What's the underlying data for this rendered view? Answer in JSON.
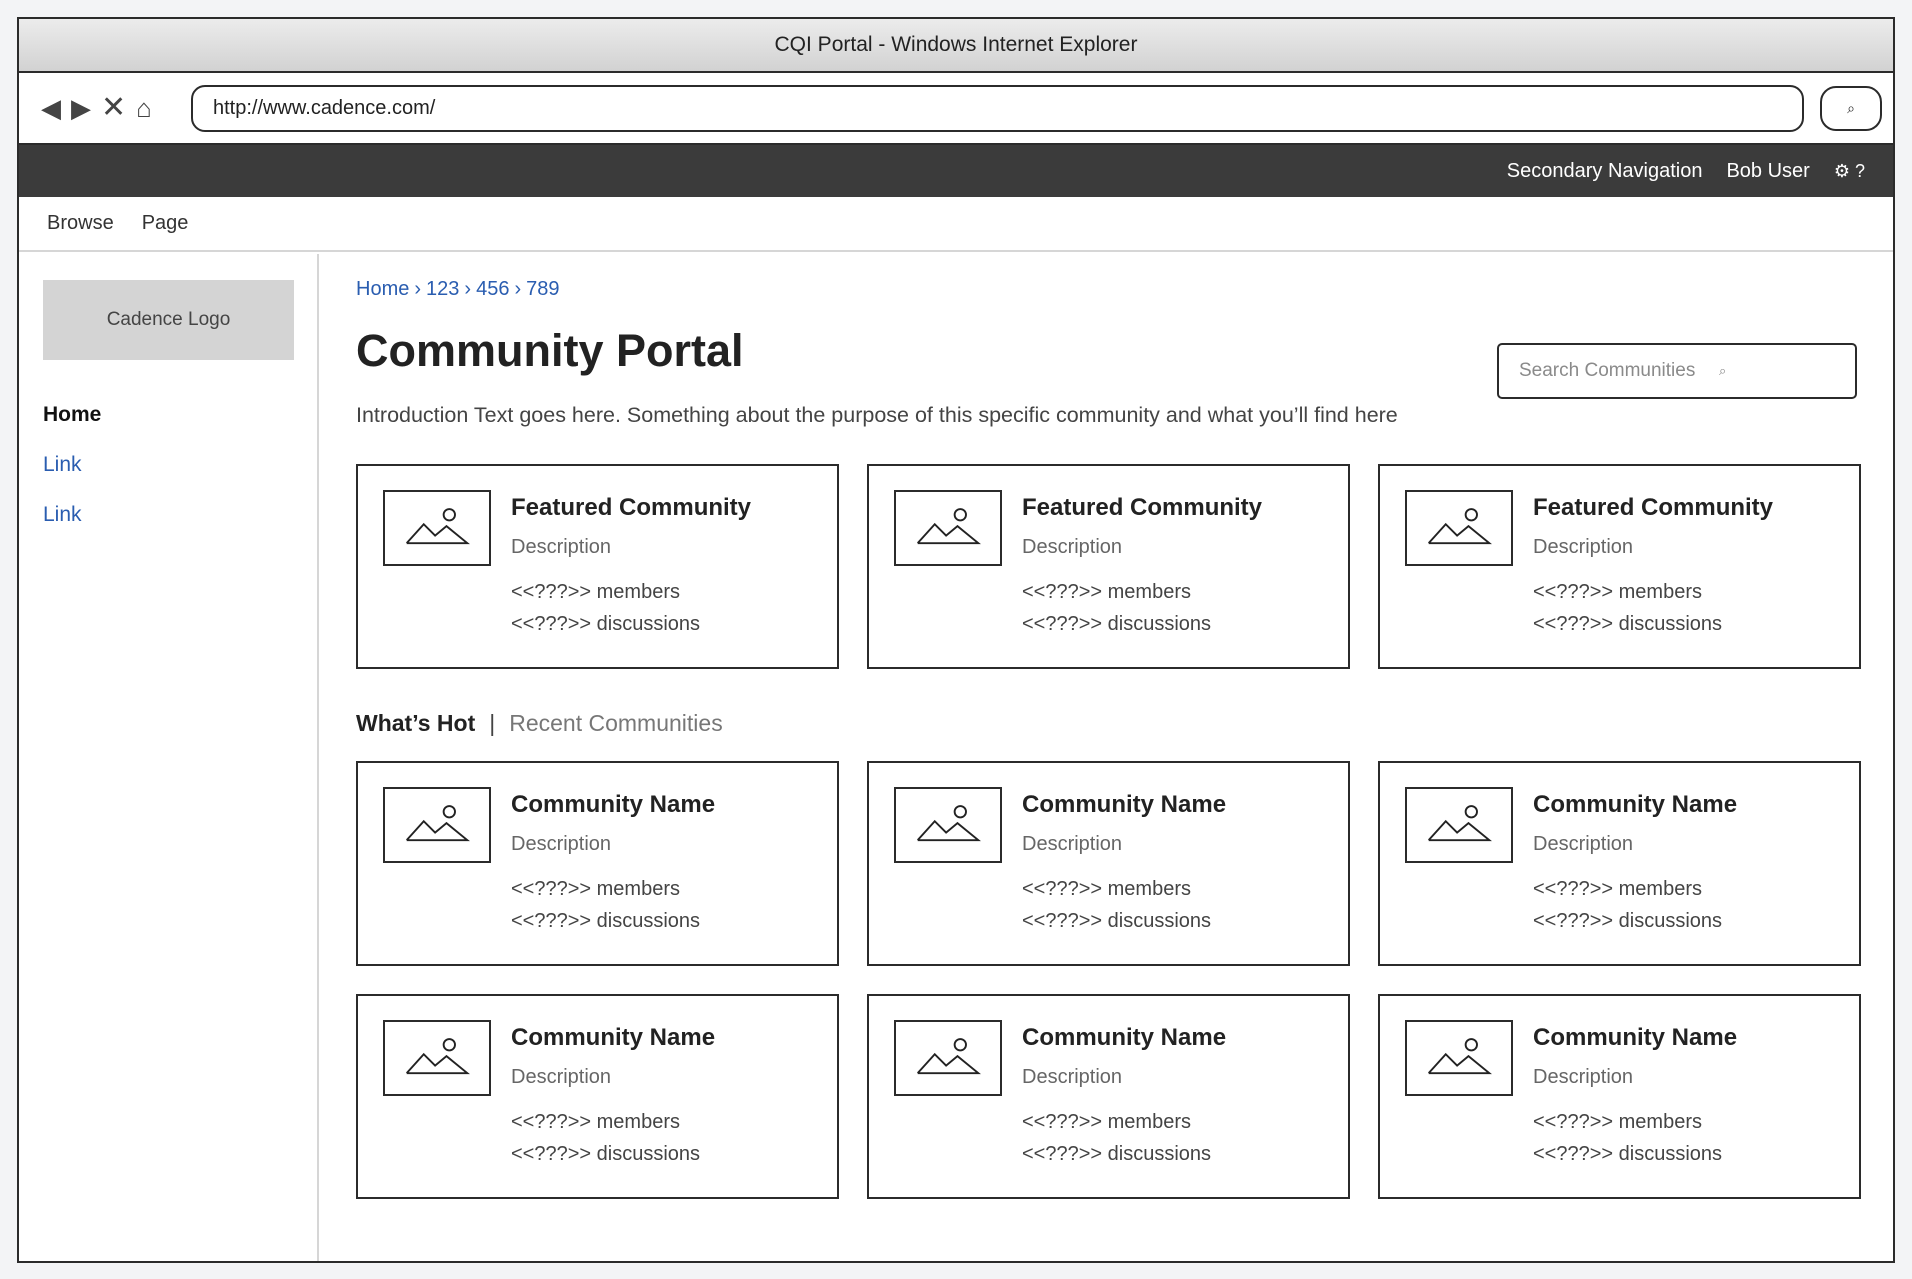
{
  "window": {
    "title": "CQI Portal - Windows Internet Explorer"
  },
  "browser": {
    "back_icon": "◀",
    "forward_icon": "▶",
    "stop_icon": "✕",
    "home_icon": "⌂",
    "url": "http://www.cadence.com/",
    "go_icon": "⌕"
  },
  "topnav": {
    "secondary": "Secondary Navigation",
    "user": "Bob User",
    "tools": "⚙ ?"
  },
  "ribbon": {
    "items": [
      "Browse",
      "Page"
    ]
  },
  "sidebar": {
    "logo": "Cadence Logo",
    "items": [
      {
        "label": "Home"
      },
      {
        "label": "Link"
      },
      {
        "label": "Link"
      }
    ]
  },
  "breadcrumb": [
    "Home",
    "123",
    "456",
    "789"
  ],
  "breadcrumb_sep": "›",
  "page": {
    "title": "Community Portal",
    "search_placeholder": "Search Communities",
    "search_icon": "⌕",
    "intro": "Introduction Text goes here. Something about the purpose of this specific community and what you’ll find here"
  },
  "featured": [
    {
      "title": "Featured Community",
      "description": "Description",
      "members": "<<???>> members",
      "discussions": "<<???>> discussions"
    },
    {
      "title": "Featured Community",
      "description": "Description",
      "members": "<<???>> members",
      "discussions": "<<???>> discussions"
    },
    {
      "title": "Featured Community",
      "description": "Description",
      "members": "<<???>> members",
      "discussions": "<<???>> discussions"
    }
  ],
  "tabs": {
    "active": "What’s Hot",
    "divider": "|",
    "inactive": "Recent Communities"
  },
  "communities": [
    {
      "title": "Community Name",
      "description": "Description",
      "members": "<<???>> members",
      "discussions": "<<???>> discussions"
    },
    {
      "title": "Community Name",
      "description": "Description",
      "members": "<<???>> members",
      "discussions": "<<???>> discussions"
    },
    {
      "title": "Community Name",
      "description": "Description",
      "members": "<<???>> members",
      "discussions": "<<???>> discussions"
    },
    {
      "title": "Community Name",
      "description": "Description",
      "members": "<<???>> members",
      "discussions": "<<???>> discussions"
    },
    {
      "title": "Community Name",
      "description": "Description",
      "members": "<<???>> members",
      "discussions": "<<???>> discussions"
    },
    {
      "title": "Community Name",
      "description": "Description",
      "members": "<<???>> members",
      "discussions": "<<???>> discussions"
    }
  ]
}
